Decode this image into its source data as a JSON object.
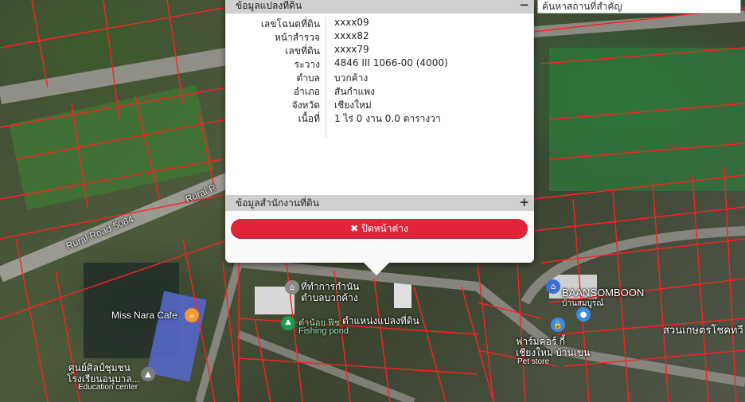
{
  "search": {
    "text": "ค้นหาสถานที่สำคัญ"
  },
  "popup": {
    "section1_title": "ข้อมูลแปลงที่ดิน",
    "section1_toggle": "−",
    "section2_title": "ข้อมูลสำนักงานที่ดิน",
    "section2_toggle": "+",
    "close_icon": "✖",
    "close_label": "ปิดหน้าต่าง",
    "rows": [
      {
        "label": "เลขโฉนดที่ดิน",
        "value": "xxxx09"
      },
      {
        "label": "หน้าสำรวจ",
        "value": "xxxx82"
      },
      {
        "label": "เลขที่ดิน",
        "value": "xxxx79"
      },
      {
        "label": "ระวาง",
        "value": "4846 III 1066-00 (4000)"
      },
      {
        "label": "ตำบล",
        "value": "บวกค้าง"
      },
      {
        "label": "อำเภอ",
        "value": "สันกำแพง"
      },
      {
        "label": "จังหวัด",
        "value": "เชียงใหม่"
      },
      {
        "label": "เนื้อที่",
        "value": "1 ไร่ 0 งาน 0.0 ตารางวา"
      }
    ]
  },
  "map": {
    "road_label_1": "Rural Road 5084",
    "road_label_2": "Rural R",
    "poi_miss_nara": "Miss Nara Cafe",
    "poi_office_1": "ที่ทำการกำนัน",
    "poi_office_2": "ตำบลบวกค้าง",
    "poi_fishing_1": "ตำน้อย ฟิช",
    "poi_fishing_2": "Fishing pond",
    "poi_parcel": "ตำแหน่งแปลงที่ดิน",
    "poi_baansomboon": "BAANSOMBOON",
    "poi_baansomboon_sub": "บ้านสมบูรณ์",
    "poi_school_1": "ศูนย์ศิลป์ชุมชน",
    "poi_school_2": "โรงเรียนอนุบาล...",
    "poi_school_3": "Education center",
    "poi_pet_1": "ฟาร์มคอร์ กี้",
    "poi_pet_2": "เชียงใหม่ บ้านเขน",
    "poi_pet_3": "Pet store",
    "poi_garden": "สวนเกษตรโชคทวี"
  }
}
